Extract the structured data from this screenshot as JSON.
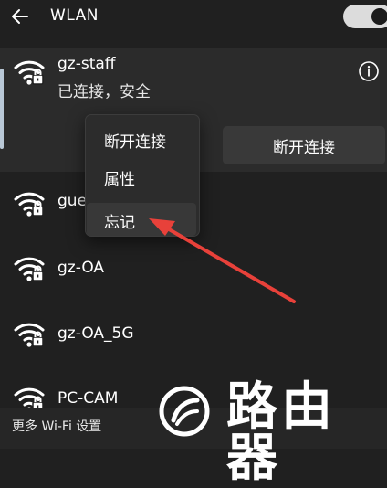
{
  "header": {
    "title": "WLAN",
    "back_icon": "arrow-left-icon",
    "toggle_on": true
  },
  "connected": {
    "ssid": "gz-staff",
    "status": "已连接，安全",
    "info_icon": "info-icon",
    "disconnect_button": "断开连接"
  },
  "context_menu": {
    "items": [
      "断开连接",
      "属性",
      "忘记"
    ],
    "highlighted_index": 2
  },
  "networks": [
    {
      "ssid": "gue",
      "secured": true
    },
    {
      "ssid": "gz-OA",
      "secured": true
    },
    {
      "ssid": "gz-OA_5G",
      "secured": true
    },
    {
      "ssid": "PC-CAM",
      "secured": true
    }
  ],
  "footer": {
    "more_settings": "更多 Wi-Fi 设置"
  },
  "watermark": {
    "text": "路由器"
  },
  "colors": {
    "background": "#202020",
    "card": "#2b2b2b",
    "menu": "#2c2c2c",
    "arrow": "#e8413a",
    "accent": "#b9c8d6"
  }
}
